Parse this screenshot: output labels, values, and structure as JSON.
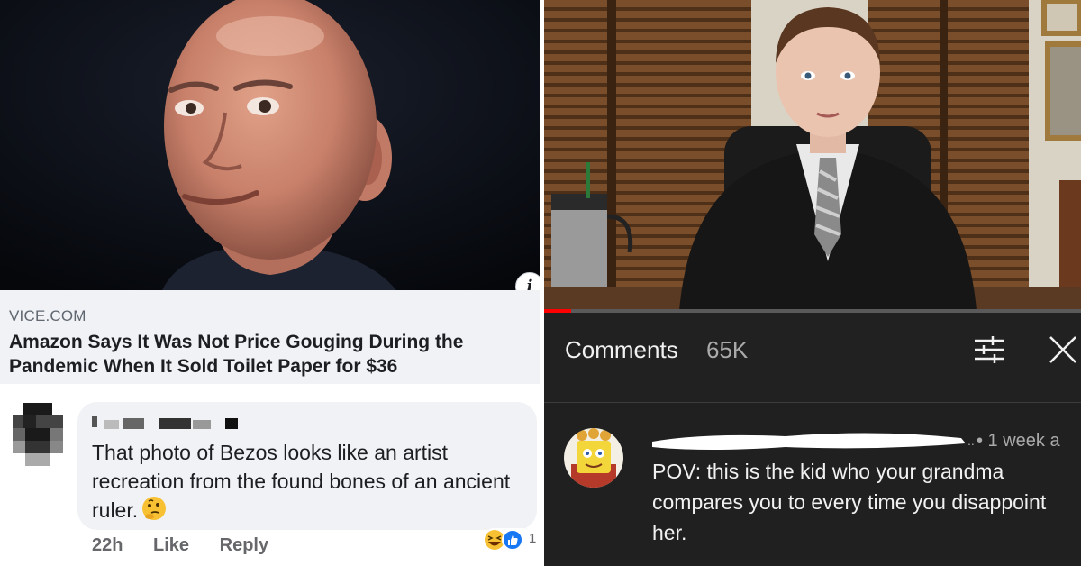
{
  "facebook_post": {
    "info_badge": "i",
    "link_source": "VICE.COM",
    "link_headline": "Amazon Says It Was Not Price Gouging During the Pandemic When It Sold Toilet Paper for $36",
    "comment": {
      "text": "That photo of Bezos looks like an artist recreation from the found bones of an ancient ruler.",
      "emoji": "thinking-face-emoji",
      "timestamp": "22h",
      "like_label": "Like",
      "reply_label": "Reply",
      "reaction_count": "1",
      "reactions": [
        "haha",
        "like"
      ]
    }
  },
  "youtube": {
    "progress_fraction": 0.05,
    "comments_title": "Comments",
    "comments_count": "65K",
    "comment": {
      "time": "• 1 week a",
      "text": "POV: this is the kid who your grandma compares you to every time you disappoint her."
    }
  },
  "colors": {
    "facebook_link_bg": "#f0f2f5",
    "facebook_text": "#1c1e21",
    "youtube_bg": "#212121",
    "youtube_progress": "#ff0000"
  }
}
